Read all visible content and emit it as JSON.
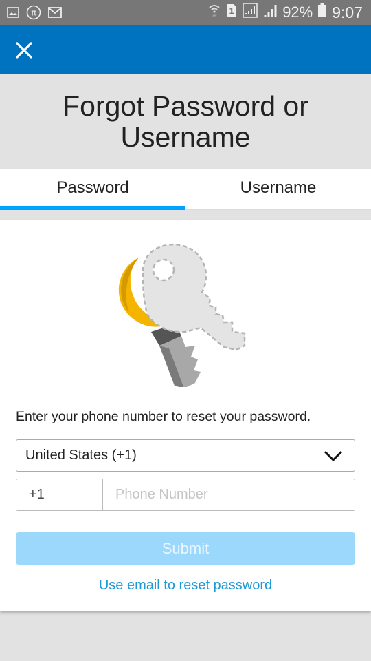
{
  "status_bar": {
    "left_icons": [
      "image-icon",
      "pi-icon",
      "gmail-icon"
    ],
    "right_icons": [
      "wifi-calling-icon",
      "sim1-icon",
      "signal-boxed-icon",
      "signal-icon"
    ],
    "battery": "92%",
    "time": "9:07"
  },
  "app_bar": {
    "close_icon": "close-icon",
    "color": "#0073c0"
  },
  "header": {
    "title": "Forgot Password or Username"
  },
  "tabs": [
    {
      "label": "Password",
      "active": true
    },
    {
      "label": "Username",
      "active": false
    }
  ],
  "form": {
    "illustration": "keys-icon",
    "instruction": "Enter your phone number to reset your password.",
    "country": {
      "selected": "United States (+1)"
    },
    "phone": {
      "prefix": "+1",
      "value": "",
      "placeholder": "Phone Number"
    },
    "submit_label": "Submit",
    "email_link": "Use email to reset password"
  },
  "colors": {
    "accent": "#00a2ff",
    "submit_disabled": "#9bd8fb",
    "link": "#1c9ad6"
  }
}
